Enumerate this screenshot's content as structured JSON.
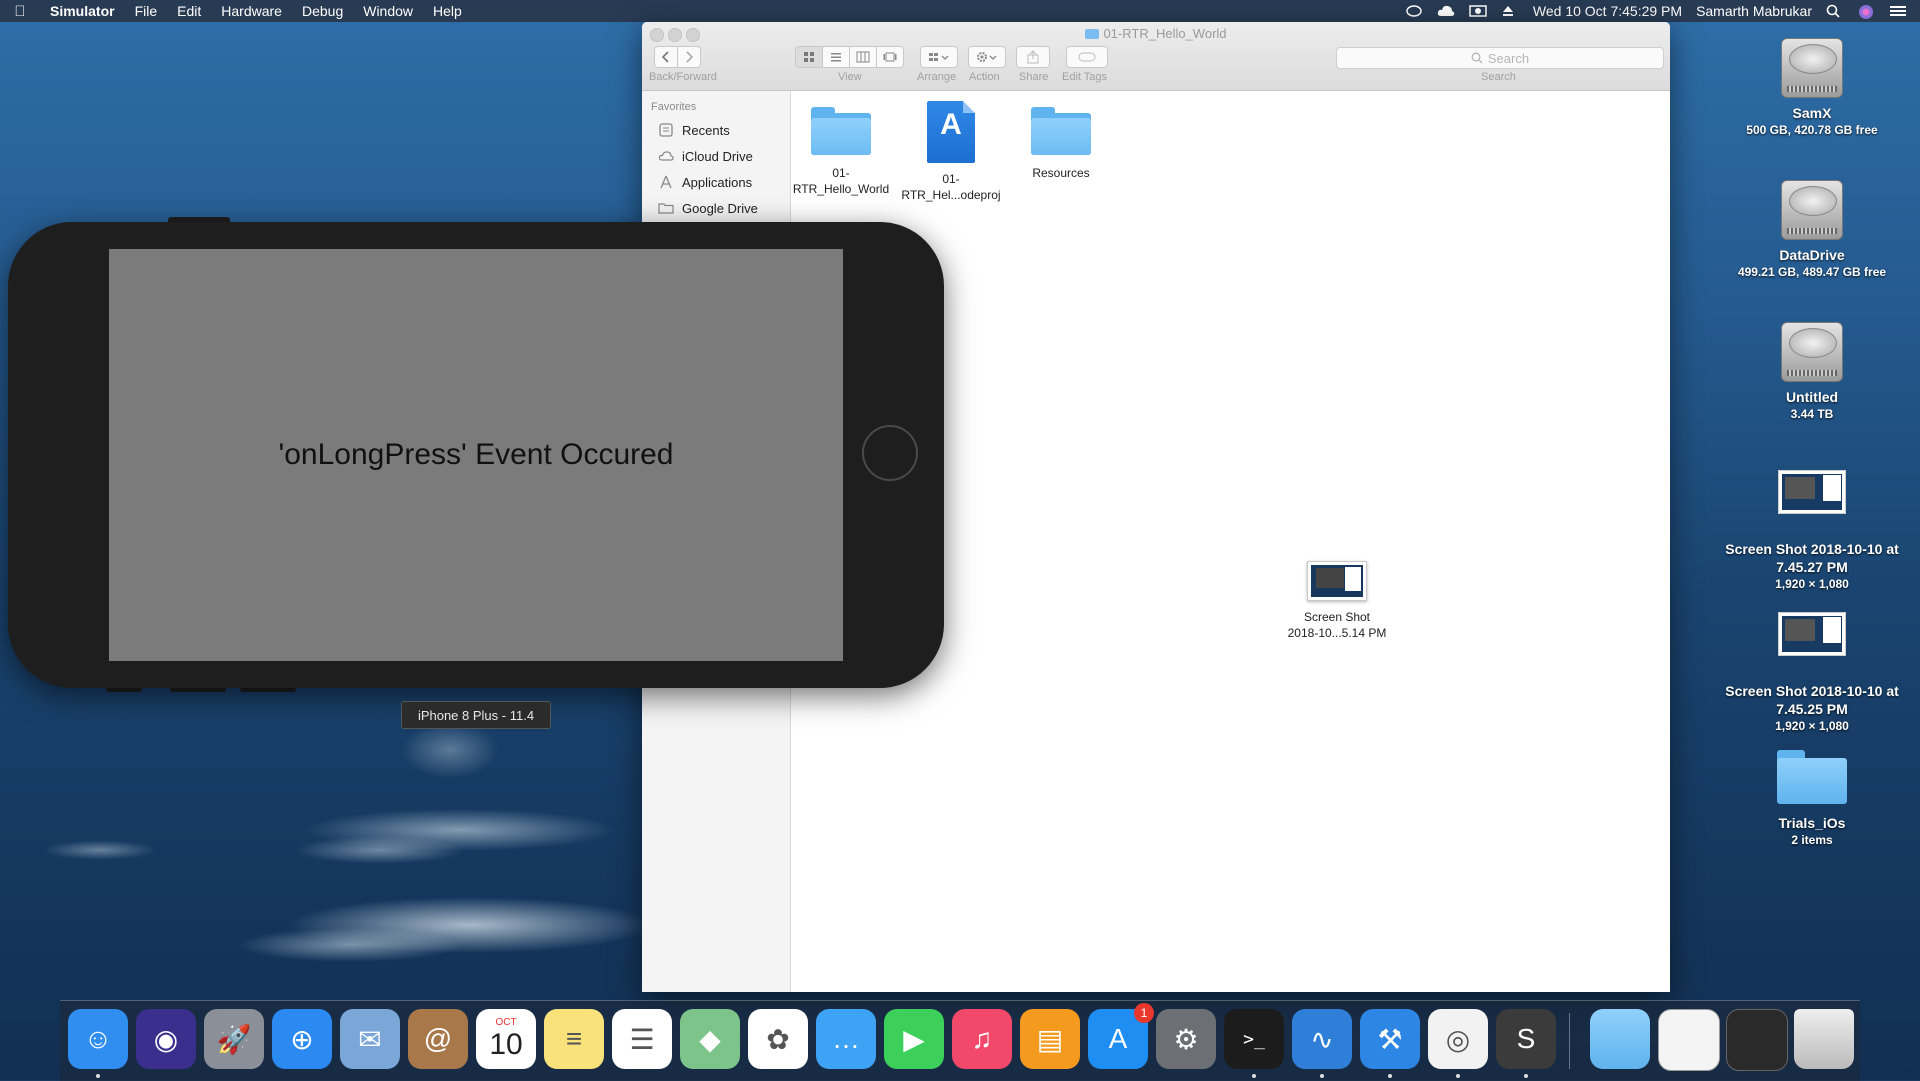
{
  "menubar": {
    "app_name": "Simulator",
    "menus": [
      "File",
      "Edit",
      "Hardware",
      "Debug",
      "Window",
      "Help"
    ],
    "datetime": "Wed 10 Oct  7:45:29 PM",
    "user": "Samarth Mabrukar"
  },
  "finder": {
    "title": "01-RTR_Hello_World",
    "toolbar": {
      "back_forward": "Back/Forward",
      "view": "View",
      "arrange": "Arrange",
      "action": "Action",
      "share": "Share",
      "edit_tags": "Edit Tags",
      "search_placeholder": "Search",
      "search_label": "Search"
    },
    "sidebar": {
      "heading": "Favorites",
      "items": [
        {
          "label": "Recents",
          "icon": "recents-icon"
        },
        {
          "label": "iCloud Drive",
          "icon": "cloud-icon"
        },
        {
          "label": "Applications",
          "icon": "applications-icon"
        },
        {
          "label": "Google Drive",
          "icon": "folder-icon"
        }
      ]
    },
    "files": [
      {
        "line1": "01-",
        "line2": "RTR_Hello_World",
        "type": "folder"
      },
      {
        "line1": "01-",
        "line2": "RTR_Hel...odeproj",
        "type": "xcodeproj"
      },
      {
        "line1": "Resources",
        "line2": "",
        "type": "folder"
      },
      {
        "line1": "Screen Shot",
        "line2": "2018-10...5.14 PM",
        "type": "screenshot"
      }
    ]
  },
  "simulator": {
    "message": "'onLongPress' Event Occured",
    "device_label": "iPhone 8 Plus - 11.4"
  },
  "desktop": {
    "items": [
      {
        "name": "SamX",
        "sub": "500 GB, 420.78 GB free",
        "type": "drive"
      },
      {
        "name": "DataDrive",
        "sub": "499.21 GB, 489.47 GB free",
        "type": "drive"
      },
      {
        "name": "Untitled",
        "sub": "3.44 TB",
        "type": "drive"
      },
      {
        "name": "Screen Shot 2018-10-10 at 7.45.27 PM",
        "sub": "1,920 × 1,080",
        "type": "screenshot"
      },
      {
        "name": "Screen Shot 2018-10-10 at 7.45.25 PM",
        "sub": "1,920 × 1,080",
        "type": "screenshot"
      },
      {
        "name": "Trials_iOs",
        "sub": "2 items",
        "type": "folder"
      }
    ]
  },
  "dock": {
    "apps": [
      {
        "name": "Finder",
        "icon": "finder-icon",
        "color": "#2f8ef0",
        "running": true
      },
      {
        "name": "Siri",
        "icon": "siri-icon",
        "color": "#3a2f8c",
        "running": false
      },
      {
        "name": "Launchpad",
        "icon": "launchpad-icon",
        "color": "#8a8f98",
        "running": false
      },
      {
        "name": "Safari",
        "icon": "safari-icon",
        "color": "#2a8af2",
        "running": false
      },
      {
        "name": "Mail",
        "icon": "mail-icon",
        "color": "#7aa6d8",
        "running": false
      },
      {
        "name": "Contacts",
        "icon": "contacts-icon",
        "color": "#a9784a",
        "running": false
      },
      {
        "name": "Calendar",
        "icon": "calendar-icon",
        "color": "#ffffff",
        "running": false,
        "month": "OCT",
        "day": "10"
      },
      {
        "name": "Notes",
        "icon": "notes-icon",
        "color": "#f9e27a",
        "running": false
      },
      {
        "name": "Reminders",
        "icon": "reminders-icon",
        "color": "#ffffff",
        "running": false
      },
      {
        "name": "Maps",
        "icon": "maps-icon",
        "color": "#7cc48a",
        "running": false
      },
      {
        "name": "Photos",
        "icon": "photos-icon",
        "color": "#ffffff",
        "running": false
      },
      {
        "name": "Messages",
        "icon": "messages-icon",
        "color": "#3ea2f5",
        "running": false
      },
      {
        "name": "FaceTime",
        "icon": "facetime-icon",
        "color": "#3ccf5a",
        "running": false
      },
      {
        "name": "iTunes",
        "icon": "itunes-icon",
        "color": "#f2496a",
        "running": false
      },
      {
        "name": "iBooks",
        "icon": "ibooks-icon",
        "color": "#f49a1e",
        "running": false
      },
      {
        "name": "App Store",
        "icon": "app-store-icon",
        "color": "#1f8ef2",
        "running": false,
        "badge": "1"
      },
      {
        "name": "System Preferences",
        "icon": "system-preferences-icon",
        "color": "#6c6f74",
        "running": false
      },
      {
        "name": "Terminal",
        "icon": "terminal-icon",
        "color": "#1c1c1c",
        "running": true
      },
      {
        "name": "Instruments",
        "icon": "instruments-icon",
        "color": "#2f7fd8",
        "running": true
      },
      {
        "name": "Xcode",
        "icon": "xcode-icon",
        "color": "#2d86e3",
        "running": true
      },
      {
        "name": "Chrome",
        "icon": "chrome-icon",
        "color": "#f2f2f2",
        "running": true
      },
      {
        "name": "Sublime Text",
        "icon": "sublime-icon",
        "color": "#3b3b3b",
        "running": true
      }
    ],
    "right_items": [
      {
        "name": "Downloads",
        "icon": "downloads-folder-icon"
      },
      {
        "name": "Minimized Chrome",
        "icon": "minimized-chrome-icon"
      },
      {
        "name": "Minimized Sublime",
        "icon": "minimized-sublime-icon"
      },
      {
        "name": "Trash",
        "icon": "trash-icon"
      }
    ]
  }
}
